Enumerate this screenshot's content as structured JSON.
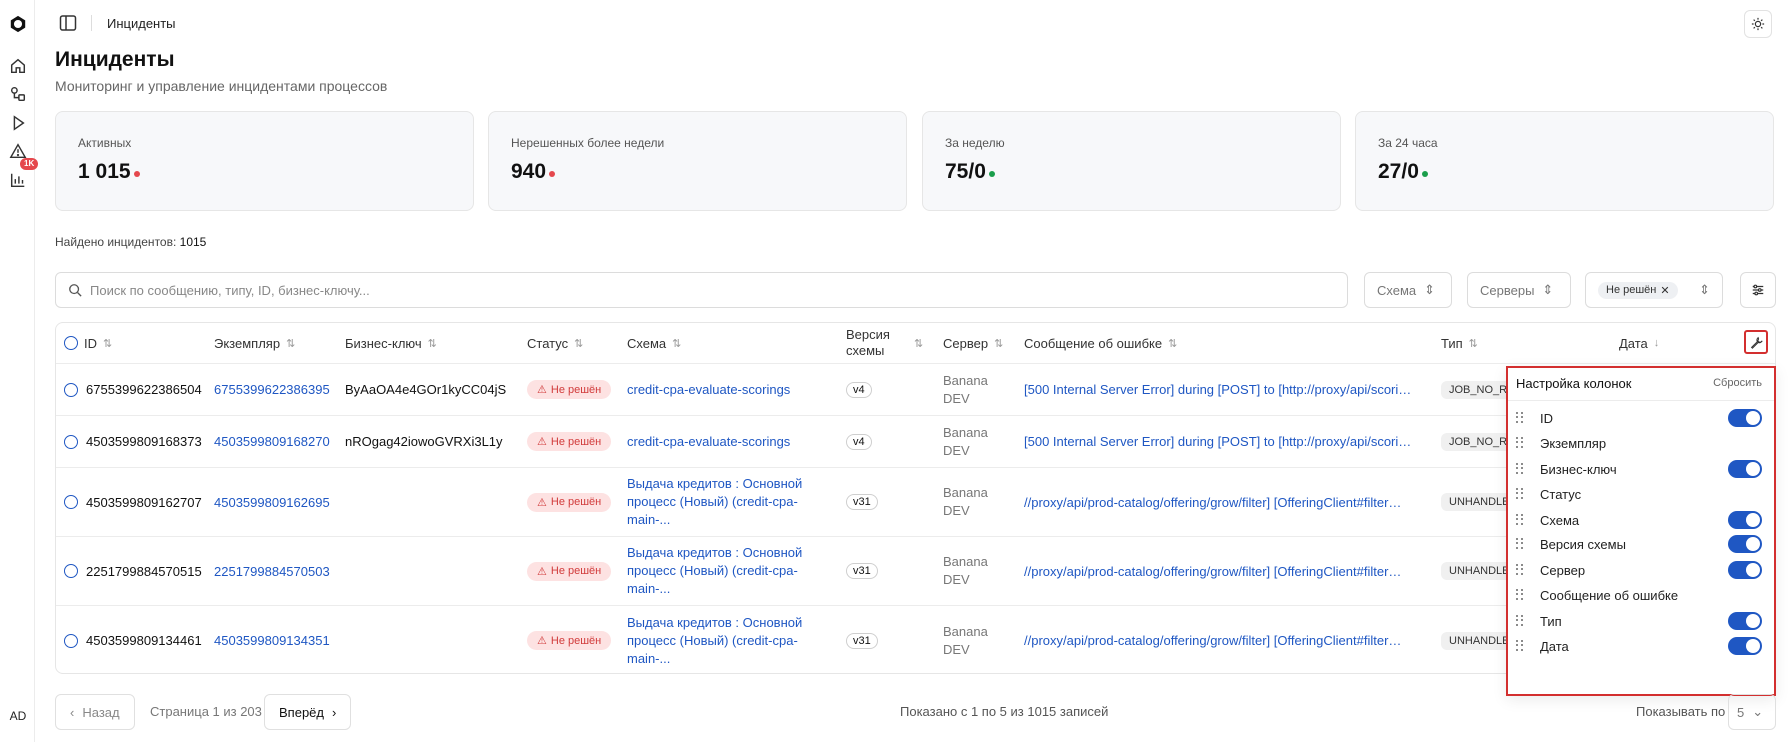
{
  "breadcrumb": "Инциденты",
  "page": {
    "title": "Инциденты",
    "subtitle": "Мониторинг и управление инцидентами процессов"
  },
  "sidebar": {
    "alerts_badge": "1K",
    "avatar": "AD"
  },
  "stats": [
    {
      "label": "Активных",
      "value": "1 015",
      "dot_color": "#e5484d"
    },
    {
      "label": "Нерешенных более недели",
      "value": "940",
      "dot_color": "#e5484d"
    },
    {
      "label": "За неделю",
      "value": "75/0",
      "dot_color": "#1a9e4b"
    },
    {
      "label": "За 24 часа",
      "value": "27/0",
      "dot_color": "#1a9e4b"
    }
  ],
  "found": {
    "label": "Найдено инцидентов:",
    "count": "1015"
  },
  "search": {
    "placeholder": "Поиск по сообщению, типу, ID, бизнес-ключу..."
  },
  "filters": {
    "schema": "Схема",
    "servers": "Серверы",
    "status_chip": "Не решён"
  },
  "columns": {
    "id": "ID",
    "instance": "Экземпляр",
    "business_key": "Бизнес-ключ",
    "status": "Статус",
    "schema": "Схема",
    "schema_version_1": "Версия",
    "schema_version_2": "схемы",
    "server": "Сервер",
    "error_message": "Сообщение об ошибке",
    "type": "Тип",
    "date": "Дата"
  },
  "rows": [
    {
      "id": "6755399622386504",
      "instance": "6755399622386395",
      "business_key": "ByAaOA4e4GOr1kyCC04jS",
      "status": "Не решён",
      "schema_lines": [
        "credit-cpa-evaluate-scorings"
      ],
      "version": "v4",
      "server_1": "Banana",
      "server_2": "DEV",
      "error": "[500 Internal Server Error] during [POST] to [http://proxy/api/scori…",
      "type": "JOB_NO_R"
    },
    {
      "id": "4503599809168373",
      "instance": "4503599809168270",
      "business_key": "nROgag42iowoGVRXi3L1y",
      "status": "Не решён",
      "schema_lines": [
        "credit-cpa-evaluate-scorings"
      ],
      "version": "v4",
      "server_1": "Banana",
      "server_2": "DEV",
      "error": "[500 Internal Server Error] during [POST] to [http://proxy/api/scori…",
      "type": "JOB_NO_R"
    },
    {
      "id": "4503599809162707",
      "instance": "4503599809162695",
      "business_key": "",
      "status": "Не решён",
      "schema_lines": [
        "Выдача кредитов : Основной",
        "процесс (Новый) (credit-cpa-",
        "main-..."
      ],
      "version": "v31",
      "server_1": "Banana",
      "server_2": "DEV",
      "error": "//proxy/api/prod-catalog/offering/grow/filter] [OfferingClient#filter…",
      "type": "UNHANDLE"
    },
    {
      "id": "2251799884570515",
      "instance": "2251799884570503",
      "business_key": "",
      "status": "Не решён",
      "schema_lines": [
        "Выдача кредитов : Основной",
        "процесс (Новый) (credit-cpa-",
        "main-..."
      ],
      "version": "v31",
      "server_1": "Banana",
      "server_2": "DEV",
      "error": "//proxy/api/prod-catalog/offering/grow/filter] [OfferingClient#filter…",
      "type": "UNHANDLE"
    },
    {
      "id": "4503599809134461",
      "instance": "4503599809134351",
      "business_key": "",
      "status": "Не решён",
      "schema_lines": [
        "Выдача кредитов : Основной",
        "процесс (Новый) (credit-cpa-",
        "main-..."
      ],
      "version": "v31",
      "server_1": "Banana",
      "server_2": "DEV",
      "error": "//proxy/api/prod-catalog/offering/grow/filter] [OfferingClient#filter…",
      "type": "UNHANDLE"
    }
  ],
  "column_settings": {
    "title": "Настройка колонок",
    "reset": "Сбросить",
    "items": [
      {
        "label": "ID",
        "enabled": true
      },
      {
        "label": "Экземпляр",
        "enabled": false
      },
      {
        "label": "Бизнес-ключ",
        "enabled": true
      },
      {
        "label": "Статус",
        "enabled": false
      },
      {
        "label": "Схема",
        "enabled": true
      },
      {
        "label": "Версия схемы",
        "enabled": true
      },
      {
        "label": "Сервер",
        "enabled": true
      },
      {
        "label": "Сообщение об ошибке",
        "enabled": false
      },
      {
        "label": "Тип",
        "enabled": true
      },
      {
        "label": "Дата",
        "enabled": true
      }
    ]
  },
  "pagination": {
    "back": "Назад",
    "page_info": "Страница 1 из 203",
    "next": "Вперёд",
    "shown": "Показано с 1 по 5 из 1015 записей",
    "per_page_label": "Показывать по",
    "per_page_value": "5"
  }
}
